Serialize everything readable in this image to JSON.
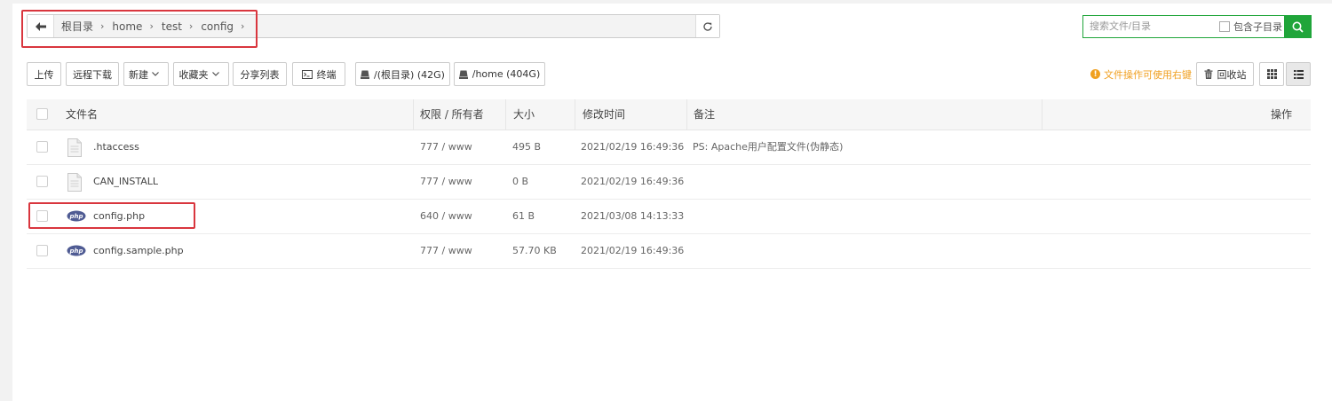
{
  "address_bar": {
    "crumbs": [
      "根目录",
      "home",
      "test",
      "config"
    ]
  },
  "search": {
    "placeholder": "搜索文件/目录",
    "include_subdir_label": "包含子目录"
  },
  "toolbar": {
    "upload": "上传",
    "remote_download": "远程下载",
    "new": "新建",
    "favorites": "收藏夹",
    "share_list": "分享列表",
    "terminal": "终端",
    "disk_root": "/(根目录) (42G)",
    "disk_home": "/home (404G)",
    "tip": "文件操作可使用右键",
    "recycle_bin": "回收站"
  },
  "table": {
    "headers": {
      "name": "文件名",
      "perm_owner": "权限 / 所有者",
      "size": "大小",
      "mtime": "修改时间",
      "remark": "备注",
      "actions": "操作"
    },
    "rows": [
      {
        "name": ".htaccess",
        "icon": "file-icon",
        "perm": "777 / www",
        "size": "495 B",
        "mtime": "2021/02/19 16:49:36",
        "remark": "PS: Apache用户配置文件(伪静态)"
      },
      {
        "name": "CAN_INSTALL",
        "icon": "file-icon",
        "perm": "777 / www",
        "size": "0 B",
        "mtime": "2021/02/19 16:49:36",
        "remark": ""
      },
      {
        "name": "config.php",
        "icon": "php-icon",
        "perm": "640 / www",
        "size": "61 B",
        "mtime": "2021/03/08 14:13:33",
        "remark": ""
      },
      {
        "name": "config.sample.php",
        "icon": "php-icon",
        "perm": "777 / www",
        "size": "57.70 KB",
        "mtime": "2021/02/19 16:49:36",
        "remark": ""
      }
    ]
  },
  "colors": {
    "accent_green": "#20a53a",
    "highlight_red": "#d9363e",
    "tip_orange": "#f0a020"
  }
}
